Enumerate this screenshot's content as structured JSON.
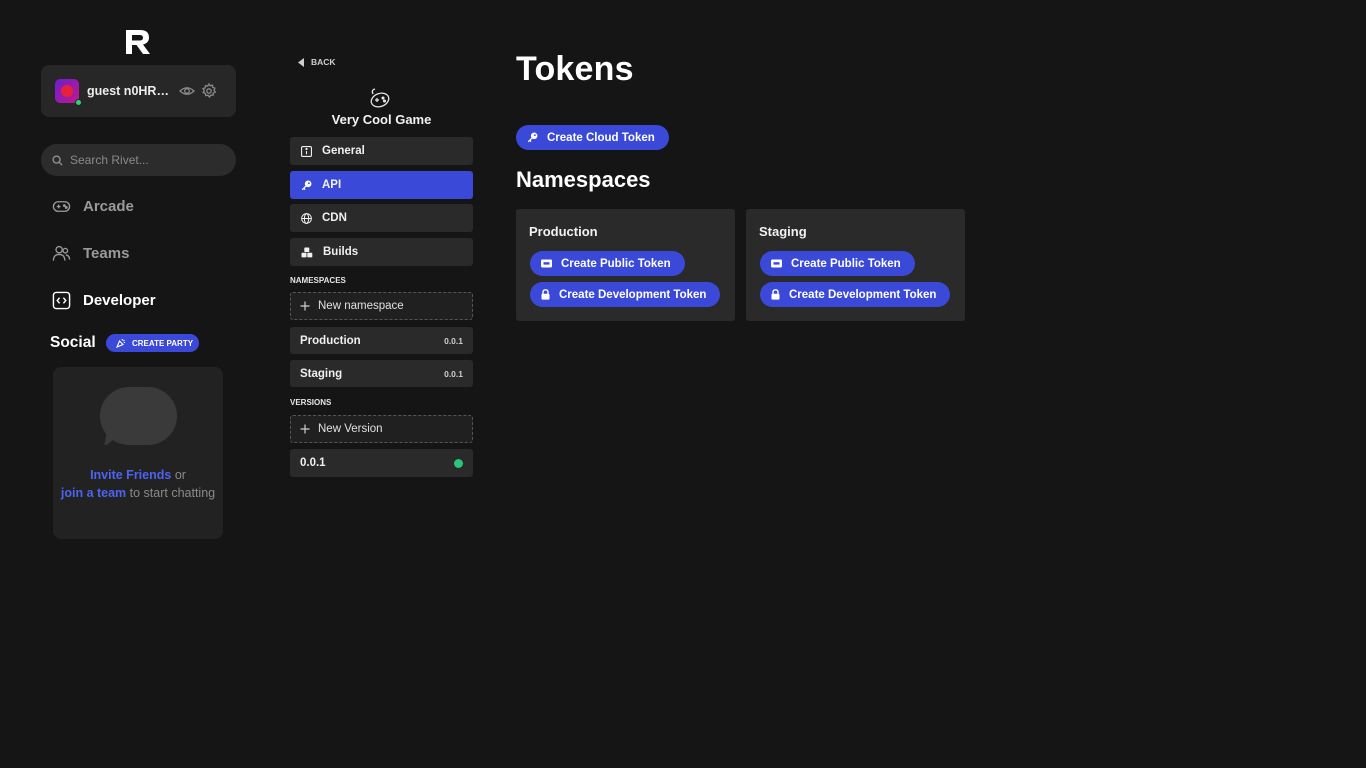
{
  "user": {
    "name": "guest n0HRvH..."
  },
  "search": {
    "placeholder": "Search Rivet..."
  },
  "nav": [
    {
      "label": "Arcade",
      "icon": "gamepad-icon"
    },
    {
      "label": "Teams",
      "icon": "users-icon"
    },
    {
      "label": "Developer",
      "icon": "code-icon"
    }
  ],
  "social": {
    "title": "Social",
    "create_party": "CREATE PARTY",
    "invite_link": "Invite Friends",
    "or_text": " or ",
    "join_link": "join a team",
    "tail_text": " to start chatting"
  },
  "game": {
    "back_label": "BACK",
    "title": "Very Cool Game",
    "menu": [
      {
        "label": "General",
        "icon": "info-icon"
      },
      {
        "label": "API",
        "icon": "key-icon"
      },
      {
        "label": "CDN",
        "icon": "globe-icon"
      },
      {
        "label": "Builds",
        "icon": "cubes-icon"
      }
    ],
    "namespaces_label": "NAMESPACES",
    "new_namespace": "New namespace",
    "namespaces": [
      {
        "name": "Production",
        "version": "0.0.1"
      },
      {
        "name": "Staging",
        "version": "0.0.1"
      }
    ],
    "versions_label": "VERSIONS",
    "new_version": "New Version",
    "versions": [
      {
        "name": "0.0.1",
        "status": "active"
      }
    ]
  },
  "main": {
    "title": "Tokens",
    "cloud_token_button": "Create Cloud Token",
    "namespaces_title": "Namespaces",
    "cards": [
      {
        "name": "Production",
        "public_button": "Create Public Token",
        "dev_button": "Create Development Token"
      },
      {
        "name": "Staging",
        "public_button": "Create Public Token",
        "dev_button": "Create Development Token"
      }
    ]
  },
  "colors": {
    "accent": "#3b49d8",
    "background": "#151515",
    "card": "#2a2a2a",
    "online": "#2bc47b",
    "link": "#4d63f2"
  }
}
